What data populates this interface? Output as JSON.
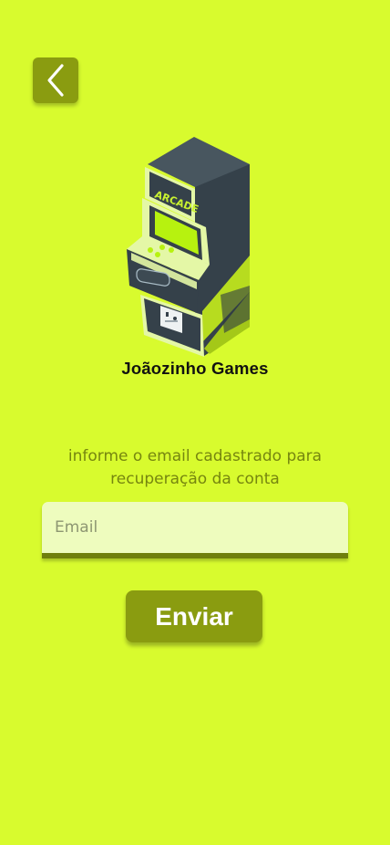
{
  "header": {
    "back_icon": "chevron-left-icon"
  },
  "brand": {
    "logo_icon": "arcade-cabinet-icon",
    "logo_text": "ARCADE",
    "name": "Joãozinho Games"
  },
  "form": {
    "instruction": "informe o email cadastrado para recuperação da conta",
    "email_placeholder": "Email",
    "email_value": "",
    "submit_label": "Enviar"
  },
  "colors": {
    "background": "#d8fb2e",
    "button": "#8a9c10",
    "input_background": "#eefcbe",
    "input_border": "#6f7f0c",
    "text_muted": "#76860f",
    "cabinet_dark": "#35414a"
  }
}
